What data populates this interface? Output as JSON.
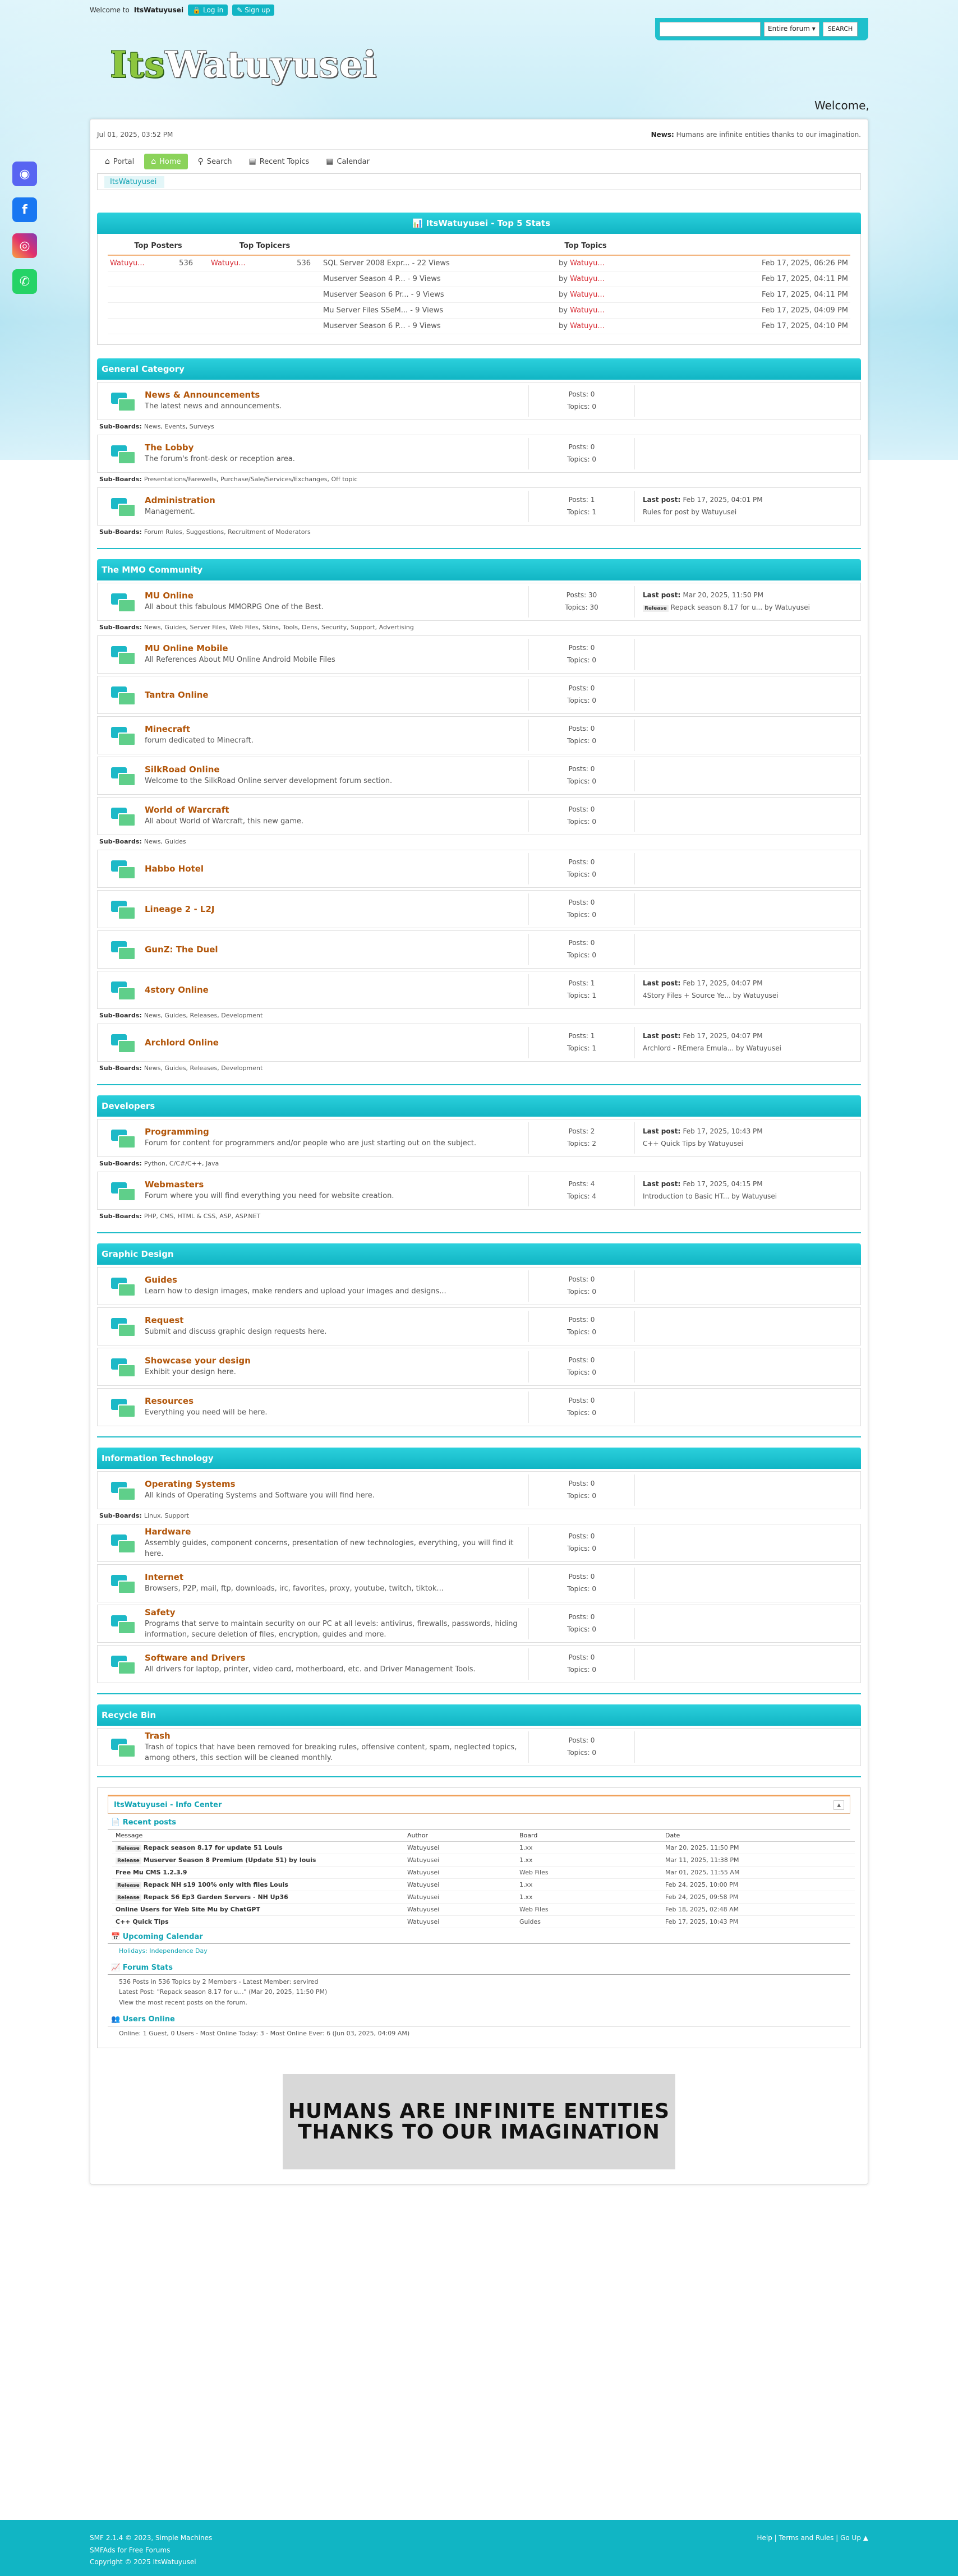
{
  "topbar": {
    "welcome": "Welcome to",
    "site": "ItsWatuyusei",
    "login": "Log in",
    "signup": "Sign up"
  },
  "search": {
    "scope": "Entire forum",
    "button": "SEARCH"
  },
  "logo": {
    "part1": "Its",
    "part2": "Watuyusei"
  },
  "header": {
    "welcome": "Welcome,"
  },
  "social": [
    "discord-icon",
    "facebook-icon",
    "instagram-icon",
    "whatsapp-icon"
  ],
  "newsbar": {
    "date": "Jul 01, 2025, 03:52 PM",
    "news_label": "News:",
    "news_text": "Humans are infinite entities thanks to our imagination."
  },
  "menu": [
    {
      "label": "Portal",
      "icon": "⌂"
    },
    {
      "label": "Home",
      "icon": "⌂"
    },
    {
      "label": "Search",
      "icon": "⚲"
    },
    {
      "label": "Recent Topics",
      "icon": "▤"
    },
    {
      "label": "Calendar",
      "icon": "▦"
    }
  ],
  "breadcrumb": "ItsWatuyusei",
  "stats": {
    "title": "ItsWatuyusei - Top 5 Stats",
    "h_posters": "Top Posters",
    "h_topicers": "Top Topicers",
    "h_topics": "Top Topics",
    "poster": "Watuyu...",
    "poster_count": "536",
    "topicer": "Watuyu...",
    "topicer_count": "536",
    "topics": [
      {
        "t": "SQL Server 2008 Expr... - 22 Views",
        "by": "Watuyu...",
        "d": "Feb 17, 2025, 06:26 PM"
      },
      {
        "t": "Muserver Season 4 P... - 9 Views",
        "by": "Watuyu...",
        "d": "Feb 17, 2025, 04:11 PM"
      },
      {
        "t": "Muserver Season 6 Pr... - 9 Views",
        "by": "Watuyu...",
        "d": "Feb 17, 2025, 04:11 PM"
      },
      {
        "t": "Mu Server Files SSeM... - 9 Views",
        "by": "Watuyu...",
        "d": "Feb 17, 2025, 04:09 PM"
      },
      {
        "t": "Muserver Season 6 P... - 9 Views",
        "by": "Watuyu...",
        "d": "Feb 17, 2025, 04:10 PM"
      }
    ]
  },
  "labels": {
    "by": "by",
    "subboards": "Sub-Boards:",
    "lastpost": "Last post:",
    "release": "Release"
  },
  "categories": [
    {
      "name": "General Category",
      "boards": [
        {
          "title": "News & Announcements",
          "desc": "The latest news and announcements.",
          "posts": "Posts: 0",
          "topics": "Topics: 0",
          "sub": "News, Events, Surveys"
        },
        {
          "title": "The Lobby",
          "desc": "The forum's front-desk or reception area.",
          "posts": "Posts: 0",
          "topics": "Topics: 0",
          "sub": "Presentations/Farewells, Purchase/Sale/Services/Exchanges, Off topic"
        },
        {
          "title": "Administration",
          "desc": "Management.",
          "posts": "Posts: 1",
          "topics": "Topics: 1",
          "last": "Feb 17, 2025, 04:01 PM",
          "lastline": "Rules for post by Watuyusei",
          "sub": "Forum Rules, Suggestions, Recruitment of Moderators"
        }
      ]
    },
    {
      "name": "The MMO Community",
      "boards": [
        {
          "title": "MU Online",
          "desc": "All about this fabulous MMORPG One of the Best.",
          "posts": "Posts: 30",
          "topics": "Topics: 30",
          "last": "Mar 20, 2025, 11:50 PM",
          "lastline": "Repack season 8.17 for u... by Watuyusei",
          "tagged": true,
          "sub": "News, Guides, Server Files, Web Files, Skins, Tools, Dens, Security, Support, Advertising"
        },
        {
          "title": "MU Online Mobile",
          "desc": "All References About MU Online Android Mobile Files",
          "posts": "Posts: 0",
          "topics": "Topics: 0"
        },
        {
          "title": "Tantra Online",
          "desc": "",
          "posts": "Posts: 0",
          "topics": "Topics: 0"
        },
        {
          "title": "Minecraft",
          "desc": "forum dedicated to Minecraft.",
          "posts": "Posts: 0",
          "topics": "Topics: 0"
        },
        {
          "title": "SilkRoad Online",
          "desc": "Welcome to the SilkRoad Online server development forum section.",
          "posts": "Posts: 0",
          "topics": "Topics: 0"
        },
        {
          "title": "World of Warcraft",
          "desc": "All about World of Warcraft, this new game.",
          "posts": "Posts: 0",
          "topics": "Topics: 0",
          "sub": "News, Guides"
        },
        {
          "title": "Habbo Hotel",
          "desc": "",
          "posts": "Posts: 0",
          "topics": "Topics: 0"
        },
        {
          "title": "Lineage 2 - L2J",
          "desc": "",
          "posts": "Posts: 0",
          "topics": "Topics: 0"
        },
        {
          "title": "GunZ: The Duel",
          "desc": "",
          "posts": "Posts: 0",
          "topics": "Topics: 0"
        },
        {
          "title": "4story Online",
          "desc": "",
          "posts": "Posts: 1",
          "topics": "Topics: 1",
          "last": "Feb 17, 2025, 04:07 PM",
          "lastline": "4Story Files + Source Ye... by Watuyusei",
          "sub": "News, Guides, Releases, Development"
        },
        {
          "title": "Archlord Online",
          "desc": "",
          "posts": "Posts: 1",
          "topics": "Topics: 1",
          "last": "Feb 17, 2025, 04:07 PM",
          "lastline": "Archlord - REmera Emula... by Watuyusei",
          "sub": "News, Guides, Releases, Development"
        }
      ]
    },
    {
      "name": "Developers",
      "boards": [
        {
          "title": "Programming",
          "desc": "Forum for content for programmers and/or people who are just starting out on the subject.",
          "posts": "Posts: 2",
          "topics": "Topics: 2",
          "last": "Feb 17, 2025, 10:43 PM",
          "lastline": "C++ Quick Tips by Watuyusei",
          "sub": "Python, C/C#/C++, Java"
        },
        {
          "title": "Webmasters",
          "desc": "Forum where you will find everything you need for website creation.",
          "posts": "Posts: 4",
          "topics": "Topics: 4",
          "last": "Feb 17, 2025, 04:15 PM",
          "lastline": "Introduction to Basic HT... by Watuyusei",
          "sub": "PHP, CMS, HTML & CSS, ASP, ASP.NET"
        }
      ]
    },
    {
      "name": "Graphic Design",
      "boards": [
        {
          "title": "Guides",
          "desc": "Learn how to design images, make renders and upload your images and designs...",
          "posts": "Posts: 0",
          "topics": "Topics: 0"
        },
        {
          "title": "Request",
          "desc": "Submit and discuss graphic design requests here.",
          "posts": "Posts: 0",
          "topics": "Topics: 0"
        },
        {
          "title": "Showcase your design",
          "desc": "Exhibit your design here.",
          "posts": "Posts: 0",
          "topics": "Topics: 0"
        },
        {
          "title": "Resources",
          "desc": "Everything you need will be here.",
          "posts": "Posts: 0",
          "topics": "Topics: 0"
        }
      ]
    },
    {
      "name": "Information Technology",
      "boards": [
        {
          "title": "Operating Systems",
          "desc": "All kinds of Operating Systems and Software you will find here.",
          "posts": "Posts: 0",
          "topics": "Topics: 0",
          "sub": "Linux, Support"
        },
        {
          "title": "Hardware",
          "desc": "Assembly guides, component concerns, presentation of new technologies, everything, you will find it here.",
          "posts": "Posts: 0",
          "topics": "Topics: 0"
        },
        {
          "title": "Internet",
          "desc": "Browsers, P2P, mail, ftp, downloads, irc, favorites, proxy, youtube, twitch, tiktok...",
          "posts": "Posts: 0",
          "topics": "Topics: 0"
        },
        {
          "title": "Safety",
          "desc": "Programs that serve to maintain security on our PC at all levels: antivirus, firewalls, passwords, hiding information, secure deletion of files, encryption, guides and more.",
          "posts": "Posts: 0",
          "topics": "Topics: 0"
        },
        {
          "title": "Software and Drivers",
          "desc": "All drivers for laptop, printer, video card, motherboard, etc. and Driver Management Tools.",
          "posts": "Posts: 0",
          "topics": "Topics: 0"
        }
      ]
    },
    {
      "name": "Recycle Bin",
      "boards": [
        {
          "title": "Trash",
          "desc": "Trash of topics that have been removed for breaking rules, offensive content, spam, neglected topics, among others, this section will be cleaned monthly.",
          "posts": "Posts: 0",
          "topics": "Topics: 0"
        }
      ]
    }
  ],
  "info": {
    "title": "ItsWatuyusei - Info Center",
    "recent_title": "Recent posts",
    "cols": [
      "Message",
      "Author",
      "Board",
      "Date"
    ],
    "recent": [
      {
        "r": true,
        "m": "Repack season 8.17 for update 51 Louis",
        "a": "Watuyusei",
        "b": "1.xx",
        "d": "Mar 20, 2025, 11:50 PM"
      },
      {
        "r": true,
        "m": "Muserver Season 8 Premium (Update 51) by louis",
        "a": "Watuyusei",
        "b": "1.xx",
        "d": "Mar 11, 2025, 11:38 PM"
      },
      {
        "r": false,
        "m": "Free Mu CMS 1.2.3.9",
        "a": "Watuyusei",
        "b": "Web Files",
        "d": "Mar 01, 2025, 11:55 AM"
      },
      {
        "r": true,
        "m": "Repack NH s19 100% only with files Louis",
        "a": "Watuyusei",
        "b": "1.xx",
        "d": "Feb 24, 2025, 10:00 PM"
      },
      {
        "r": true,
        "m": "Repack S6 Ep3 Garden Servers - NH Up36",
        "a": "Watuyusei",
        "b": "1.xx",
        "d": "Feb 24, 2025, 09:58 PM"
      },
      {
        "r": false,
        "m": "Online Users for Web Site Mu by ChatGPT",
        "a": "Watuyusei",
        "b": "Web Files",
        "d": "Feb 18, 2025, 02:48 AM"
      },
      {
        "r": false,
        "m": "C++ Quick Tips",
        "a": "Watuyusei",
        "b": "Guides",
        "d": "Feb 17, 2025, 10:43 PM"
      }
    ],
    "cal_title": "Upcoming Calendar",
    "cal_item": "Holidays: Independence Day",
    "fs_title": "Forum Stats",
    "fs_line1": "536 Posts in 536 Topics by 2 Members - Latest Member: servired",
    "fs_line2": "Latest Post: \"Repack season 8.17 for u...\" (Mar 20, 2025, 11:50 PM)",
    "fs_line3": "View the most recent posts on the forum.",
    "uo_title": "Users Online",
    "uo_line": "Online: 1 Guest, 0 Users - Most Online Today: 3 - Most Online Ever: 6 (Jun 03, 2025, 04:09 AM)"
  },
  "banner": {
    "line1": "HUMANS ARE INFINITE ENTITIES",
    "line2": "THANKS TO OUR IMAGINATION"
  },
  "footer": {
    "l1": "SMF 2.1.4 © 2023, Simple Machines",
    "l2": "SMFAds for Free Forums",
    "l3": "Copyright © 2025 ItsWatuyusei",
    "right": "Help | Terms and Rules | Go Up ▲"
  }
}
